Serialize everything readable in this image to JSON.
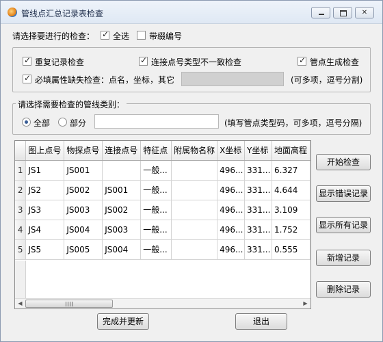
{
  "window": {
    "title": "管线点汇总记录表检查"
  },
  "check_options": {
    "prompt": "请选择要进行的检查：",
    "select_all": {
      "label": "全选",
      "checked": true
    },
    "with_suffix": {
      "label": "带缀编号",
      "checked": false
    }
  },
  "checks": {
    "duplicate": {
      "label": "重复记录检查",
      "checked": true
    },
    "connect_type": {
      "label": "连接点号类型不一致检查",
      "checked": true
    },
    "pipe_generate": {
      "label": "管点生成检查",
      "checked": true
    },
    "required_attr": {
      "label": "必填属性缺失检查：点名，坐标，其它",
      "checked": true
    },
    "required_attr_value": "",
    "required_attr_hint": "(可多项，逗号分割)"
  },
  "category_group": {
    "title": "请选择需要检查的管线类别：",
    "all": {
      "label": "全部",
      "selected": true
    },
    "partial": {
      "label": "部分",
      "selected": false
    },
    "partial_value": "",
    "hint": "(填写管点类型码，可多项，逗号分隔)"
  },
  "table": {
    "columns": [
      "图上点号",
      "物探点号",
      "连接点号",
      "特征点",
      "附属物名称",
      "X坐标",
      "Y坐标",
      "地面高程"
    ],
    "rows": [
      {
        "num": "1",
        "cells": [
          "JS1",
          "JS001",
          "",
          "一般...",
          "",
          "496...",
          "331...",
          "6.327"
        ]
      },
      {
        "num": "2",
        "cells": [
          "JS2",
          "JS002",
          "JS001",
          "一般...",
          "",
          "496...",
          "331...",
          "4.644"
        ]
      },
      {
        "num": "3",
        "cells": [
          "JS3",
          "JS003",
          "JS002",
          "一般...",
          "",
          "496...",
          "331...",
          "3.109"
        ]
      },
      {
        "num": "4",
        "cells": [
          "JS4",
          "JS004",
          "JS003",
          "一般...",
          "",
          "496...",
          "331...",
          "1.752"
        ]
      },
      {
        "num": "5",
        "cells": [
          "JS5",
          "JS005",
          "JS004",
          "一般...",
          "",
          "496...",
          "331...",
          "0.555"
        ]
      }
    ]
  },
  "actions": {
    "start_check": "开始检查",
    "show_errors": "显示错误记录",
    "show_all": "显示所有记录",
    "add_record": "新增记录",
    "delete_record": "删除记录",
    "finish_update": "完成并更新",
    "exit": "退出"
  },
  "icons": {
    "app": "app-logo-icon",
    "minimize": "minimize-icon",
    "maximize": "maximize-icon",
    "close": "close-icon",
    "scroll_left": "arrow-left-icon",
    "scroll_right": "arrow-right-icon"
  },
  "colors": {
    "window_bg": "#f0f0f0",
    "titlebar": "#dfe8f4",
    "grey_field": "#d0d0d0"
  }
}
